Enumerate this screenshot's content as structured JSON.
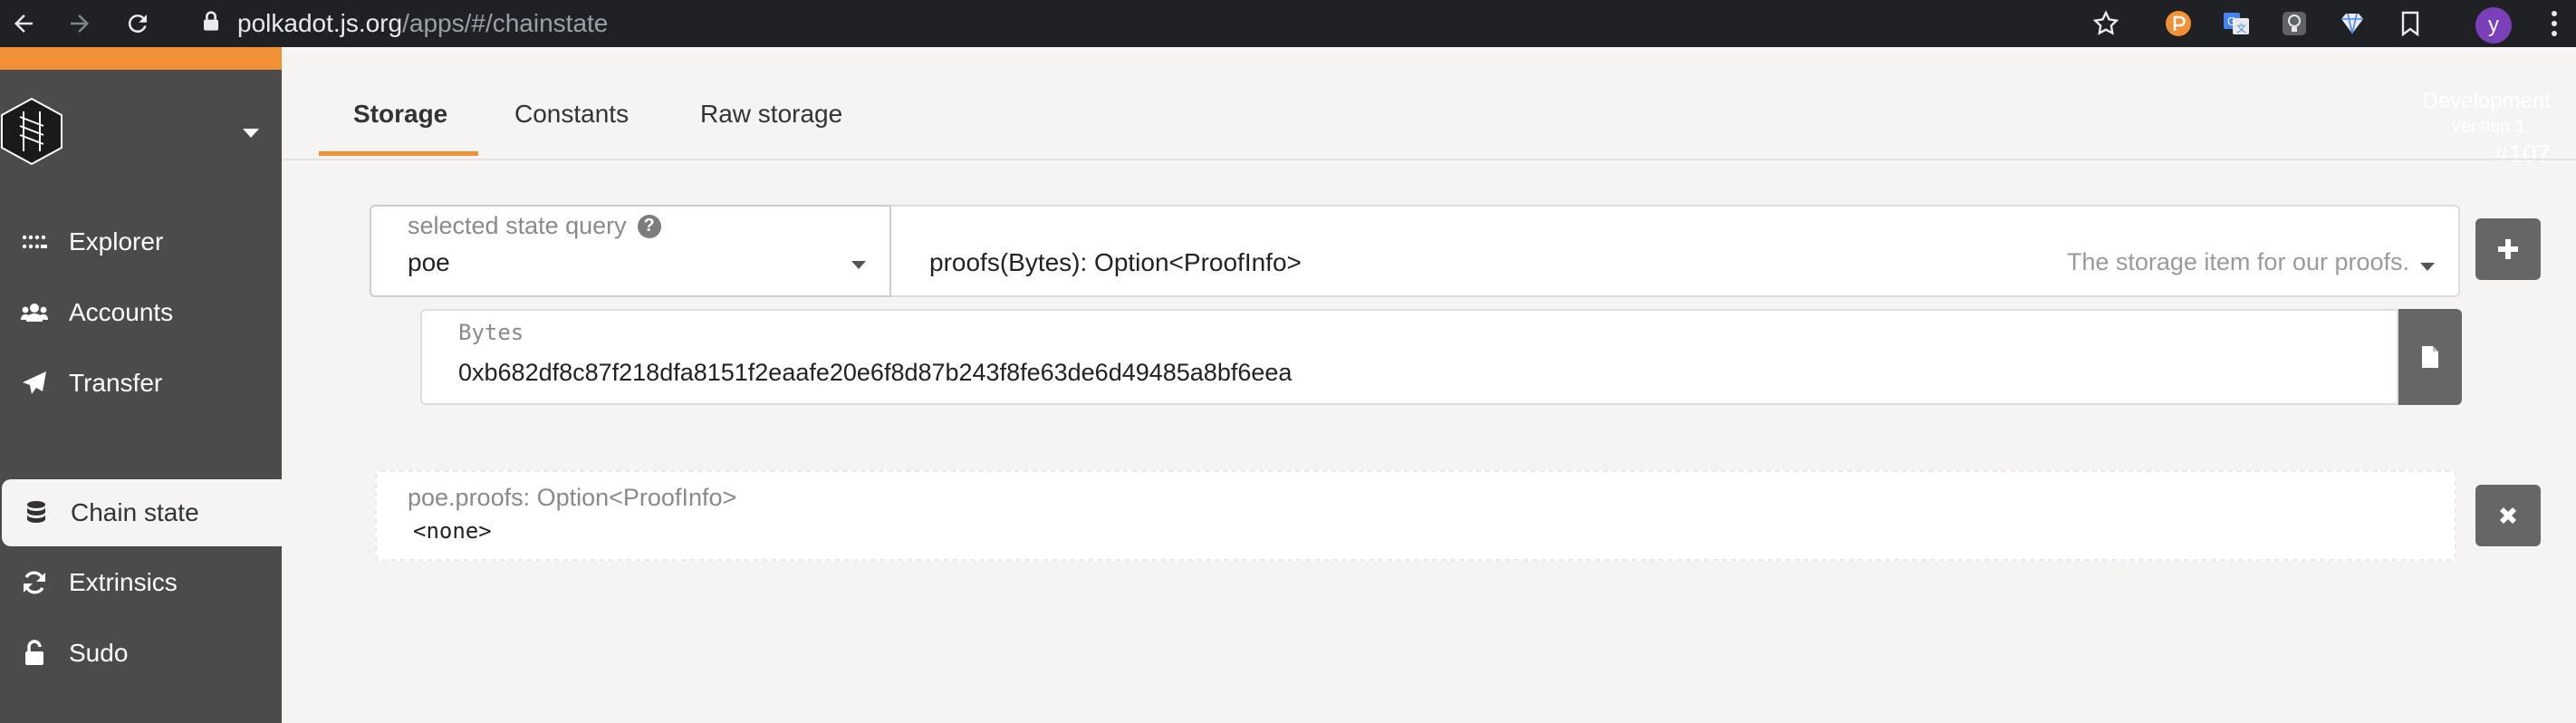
{
  "browser": {
    "url_host": "polkadot.js.org",
    "url_path": "/apps/#/chainstate",
    "profile_initial": "y",
    "extensions": [
      "polkadot-extension-icon",
      "google-translate-icon",
      "lightbulb-extension-icon",
      "diamond-extension-icon",
      "bookmark-extension-icon"
    ]
  },
  "chain": {
    "name": "Development",
    "version": "version 1",
    "block": "#107"
  },
  "sidebar": {
    "items": [
      {
        "label": "Explorer",
        "icon": "explorer-icon"
      },
      {
        "label": "Accounts",
        "icon": "users-icon"
      },
      {
        "label": "Transfer",
        "icon": "paper-plane-icon"
      },
      {
        "label": "Chain state",
        "icon": "database-icon",
        "active": true
      },
      {
        "label": "Extrinsics",
        "icon": "sync-icon"
      },
      {
        "label": "Sudo",
        "icon": "unlock-icon"
      }
    ]
  },
  "tabs": [
    {
      "label": "Storage",
      "active": true
    },
    {
      "label": "Constants"
    },
    {
      "label": "Raw storage"
    }
  ],
  "query": {
    "label": "selected state query",
    "module": "poe",
    "method": "proofs(Bytes): Option<ProofInfo>",
    "description": "The storage item for our proofs."
  },
  "param": {
    "label": "Bytes",
    "value": "0xb682df8c87f218dfa8151f2eaafe20e6f8d87b243f8fe63de6d49485a8bf6eea"
  },
  "result": {
    "label": "poe.proofs: Option<ProofInfo>",
    "value": "<none>"
  },
  "colors": {
    "accent": "#f19135",
    "sidebar_bg": "#4b4b4b",
    "page_bg": "#f5f4f3",
    "button_bg": "#666666"
  }
}
